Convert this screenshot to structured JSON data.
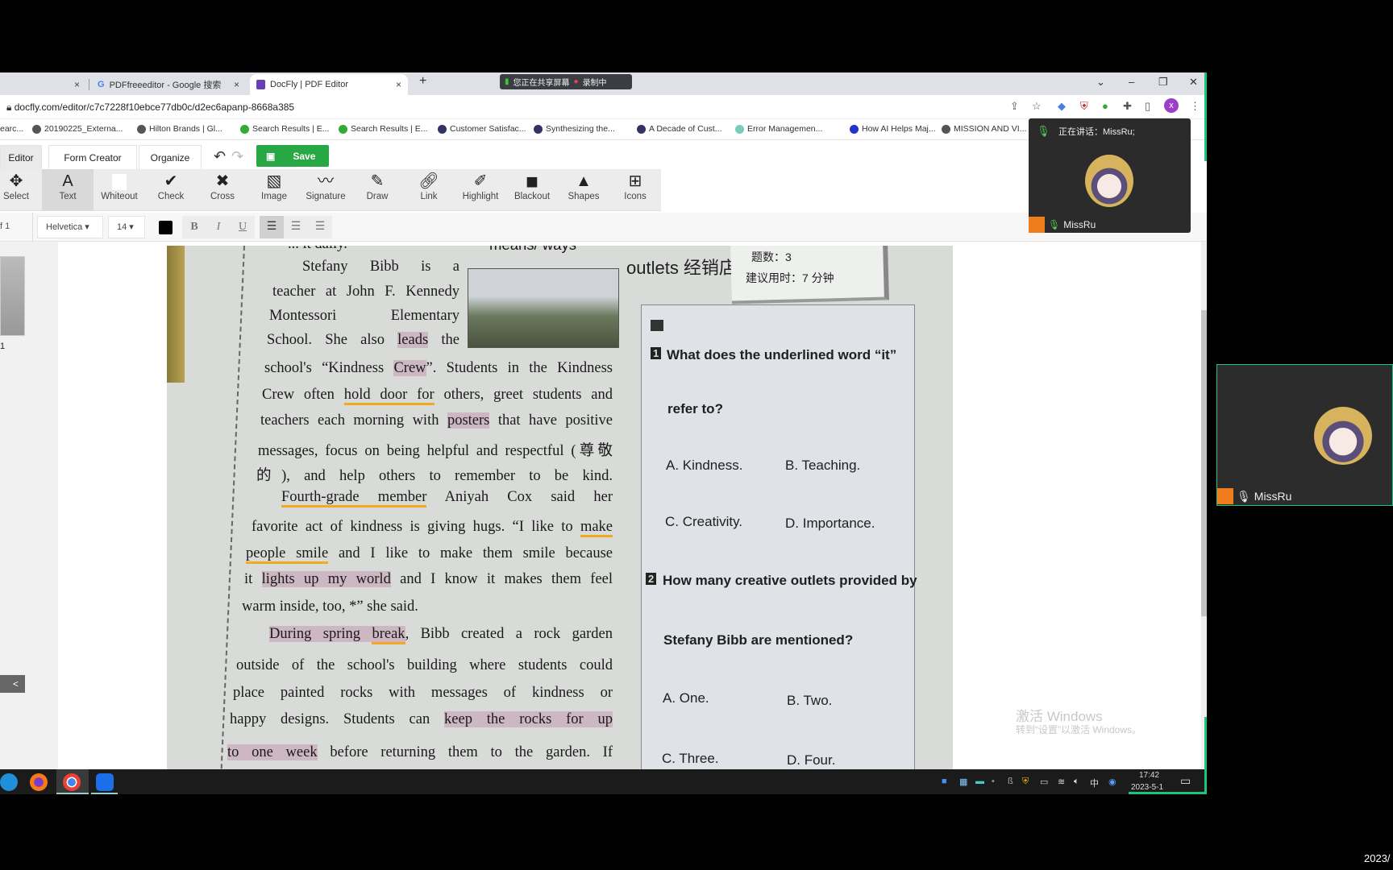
{
  "browser": {
    "tabs": [
      {
        "label": "",
        "close": "×"
      },
      {
        "label": "PDFfreeeditor - Google 搜索",
        "close": "×"
      },
      {
        "label": "DocFly | PDF Editor",
        "close": "×"
      }
    ],
    "new_tab": "+",
    "share_banner": {
      "sharing": "您正在共享屏幕",
      "recording": "录制中"
    },
    "window_controls": {
      "chevron": "⌄",
      "minimize": "–",
      "restore": "❐",
      "close": "✕"
    },
    "url": "docfly.com/editor/c7c7228f10ebce77db0c/d2ec6apanp-8668a385",
    "profile_initial": "x",
    "bookmarks": [
      "earc...",
      "20190225_Externa...",
      "Hilton Brands | Gl...",
      "Search Results | E...",
      "Search Results | E...",
      "Customer Satisfac...",
      "Synthesizing the...",
      "A Decade of Cust...",
      "Error Managemen...",
      "How AI Helps Maj...",
      "MISSION AND VI..."
    ]
  },
  "editor": {
    "mode_tabs": [
      "Editor",
      "Form Creator",
      "Organize"
    ],
    "active_mode": "Editor",
    "save_label": "Save",
    "tools": [
      {
        "label": "Select",
        "icon": "move-icon"
      },
      {
        "label": "Text",
        "icon": "text-icon"
      },
      {
        "label": "Whiteout",
        "icon": "whiteout-icon"
      },
      {
        "label": "Check",
        "icon": "check-icon"
      },
      {
        "label": "Cross",
        "icon": "cross-icon"
      },
      {
        "label": "Image",
        "icon": "image-icon"
      },
      {
        "label": "Signature",
        "icon": "signature-icon"
      },
      {
        "label": "Draw",
        "icon": "pencil-icon"
      },
      {
        "label": "Link",
        "icon": "link-icon"
      },
      {
        "label": "Highlight",
        "icon": "highlighter-icon"
      },
      {
        "label": "Blackout",
        "icon": "blackout-icon"
      },
      {
        "label": "Shapes",
        "icon": "shapes-icon"
      },
      {
        "label": "Icons",
        "icon": "plus-square-icon"
      }
    ],
    "active_tool": "Text",
    "page_of": "f 1",
    "font": "Helvetica",
    "font_size": "14",
    "text_color": "#000000",
    "format": {
      "bold": "B",
      "italic": "I",
      "underline": "U"
    },
    "thumbnail_page": "1",
    "collapse": "<"
  },
  "document": {
    "top_partial": "... it daily.",
    "top_partial_right": "means/ ways",
    "lines": [
      [
        {
          "t": "Stefany Bibb is a"
        }
      ],
      [
        {
          "t": "teacher at John F. Kennedy"
        }
      ],
      [
        {
          "t": "Montessori Elementary"
        }
      ],
      [
        {
          "t": "School. She also "
        },
        {
          "t": "leads",
          "hl": true
        },
        {
          "t": " the"
        }
      ],
      [
        {
          "t": "school's “Kindness "
        },
        {
          "t": "Crew",
          "hl": true
        },
        {
          "t": "”. Students in the Kindness"
        }
      ],
      [
        {
          "t": "Crew often "
        },
        {
          "t": "hold door for",
          "ul": true
        },
        {
          "t": " others, greet students and"
        }
      ],
      [
        {
          "t": "teachers each morning with "
        },
        {
          "t": "posters",
          "hl": true
        },
        {
          "t": " that have positive"
        }
      ],
      [
        {
          "t": "messages, focus on being helpful and respectful (尊敬"
        }
      ],
      [
        {
          "t": "的), and help others to remember to be kind."
        }
      ],
      [
        {
          "t": "Fourth-grade member",
          "ul": true
        },
        {
          "t": " Aniyah Cox said her"
        }
      ],
      [
        {
          "t": "favorite act of kindness is giving hugs. “I like to "
        },
        {
          "t": "make",
          "ul": true
        }
      ],
      [
        {
          "t": "people smile",
          "ul": true
        },
        {
          "t": " and I like to make them smile because"
        }
      ],
      [
        {
          "t": "it "
        },
        {
          "t": "lights up my world",
          "hl": true
        },
        {
          "t": " and I know it makes them feel"
        }
      ],
      [
        {
          "t": "warm inside, too, *” she said."
        }
      ],
      [
        {
          "t": "During spring ",
          "hl": true
        },
        {
          "t": "break",
          "hl": true,
          "ul": true
        },
        {
          "t": ", Bibb created a rock garden"
        }
      ],
      [
        {
          "t": "outside of the school's building where students could"
        }
      ],
      [
        {
          "t": "place painted rocks with messages of kindness or"
        }
      ],
      [
        {
          "t": "happy designs. Students can "
        },
        {
          "t": "keep the rocks for up",
          "hl": true
        }
      ],
      [
        {
          "t": "to one week",
          "hl": true
        },
        {
          "t": " before returning them to the garden. If"
        }
      ]
    ],
    "note": "outlets 经销店",
    "card": {
      "count": "题数：3",
      "time": "建议用时：7 分钟"
    },
    "questions": [
      {
        "num": "1",
        "text1": "What does the underlined word “it”",
        "text2": "refer to?",
        "options": [
          "A. Kindness.",
          "B. Teaching.",
          "C. Creativity.",
          "D. Importance."
        ]
      },
      {
        "num": "2",
        "text1": "How many creative outlets provided by",
        "text2": "Stefany Bibb are mentioned?",
        "options": [
          "A. One.",
          "B. Two.",
          "C. Three.",
          "D. Four."
        ]
      }
    ]
  },
  "watermark": {
    "line1": "激活 Windows",
    "line2": "转到“设置”以激活 Windows。"
  },
  "taskbar": {
    "time": "17:42",
    "date": "2023-5-1",
    "ime": "中"
  },
  "meeting": {
    "speaking": "正在讲话：MissRu;",
    "participant": "MissRu"
  },
  "corner_date": "2023/",
  "colors": {
    "save": "#28a745",
    "highlight": "#cdb7c3",
    "underline": "#f5a623",
    "meeting_border": "#18c77d"
  }
}
